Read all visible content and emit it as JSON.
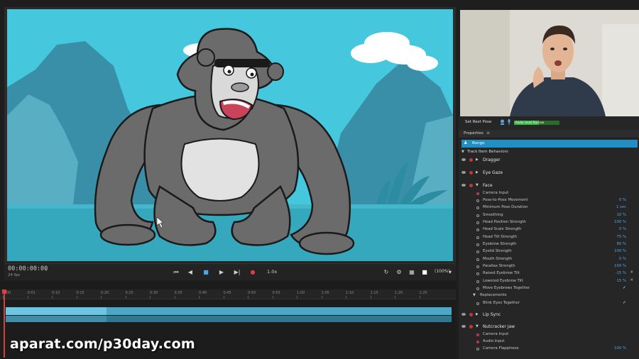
{
  "transport": {
    "timecode": "00:00:00:00",
    "fps": "24 fps",
    "speed": "1.0x",
    "zoom": "(100%)"
  },
  "timeline": {
    "ticks": [
      "0:00",
      "0:01",
      "0:10",
      "0:15",
      "0:20",
      "0:25",
      "0:30",
      "0:35",
      "0:40",
      "0:45",
      "0:50",
      "0:55",
      "1:00",
      "1:05",
      "1:10",
      "1:15",
      "1:20",
      "1:25"
    ]
  },
  "watermark": "aparat.com/p30day.com",
  "rest_pose": {
    "label": "Set Rest Pose",
    "audio_meter_text": "Audio Level Too Low",
    "audio_level": 0.55
  },
  "properties": {
    "title": "Properties",
    "puppet_name": "Bongo",
    "section_label": "Track Item Behaviors",
    "behaviors": [
      {
        "name": "Dragger",
        "expanded": false
      },
      {
        "name": "Eye Gaze",
        "expanded": false
      },
      {
        "name": "Face",
        "expanded": true
      },
      {
        "name": "Lip Sync",
        "expanded": false
      },
      {
        "name": "Nutcracker Jaw",
        "expanded": true
      }
    ],
    "face_params": [
      {
        "name": "Camera Input",
        "value": "",
        "kind": "red"
      },
      {
        "name": "Pose-to-Pose Movement",
        "value": "0 %"
      },
      {
        "name": "Minimum Pose Duration",
        "value": "1 sec"
      },
      {
        "name": "Smoothing",
        "value": "10 %"
      },
      {
        "name": "Head Position Strength",
        "value": "100 %"
      },
      {
        "name": "Head Scale Strength",
        "value": "0 %"
      },
      {
        "name": "Head Tilt Strength",
        "value": "75 %"
      },
      {
        "name": "Eyebrow Strength",
        "value": "80 %"
      },
      {
        "name": "Eyelid Strength",
        "value": "100 %"
      },
      {
        "name": "Mouth Strength",
        "value": "0 %"
      },
      {
        "name": "Parallax Strength",
        "value": "100 %"
      },
      {
        "name": "Raised Eyebrow Tilt",
        "value": "-15 %",
        "x": true
      },
      {
        "name": "Lowered Eyebrow Tilt",
        "value": "15 %",
        "x": true
      },
      {
        "name": "Move Eyebrows Together",
        "value": "",
        "check": true
      }
    ],
    "replacements_label": "Replacements",
    "blink_label": "Blink Eyes Together",
    "nutcracker_params": [
      {
        "name": "Camera Input",
        "value": "",
        "kind": "red"
      },
      {
        "name": "Audio Input",
        "value": "",
        "kind": "red"
      },
      {
        "name": "Camera Flappiness",
        "value": "100 %"
      }
    ]
  },
  "icons": {
    "play": "play-icon",
    "record": "record-icon",
    "eye": "eye-icon",
    "menu": "menu-icon"
  },
  "colors": {
    "accent": "#1f8fc6",
    "scene_sky": "#45c7de",
    "track": "#4aa8c6",
    "record": "#d94040"
  }
}
